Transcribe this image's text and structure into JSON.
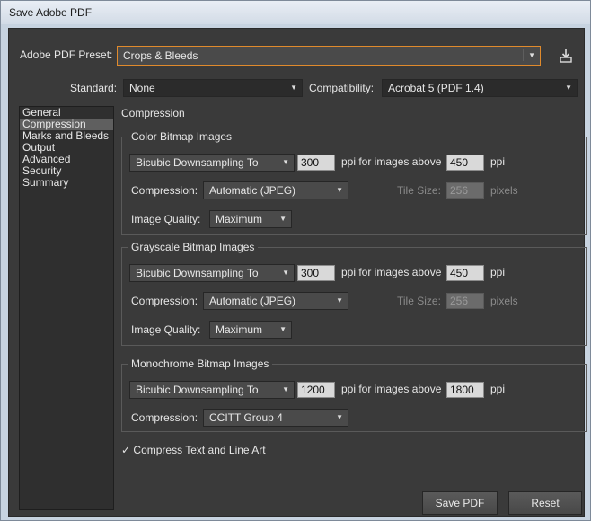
{
  "window": {
    "title": "Save Adobe PDF"
  },
  "preset": {
    "label": "Adobe PDF Preset:",
    "value": "Crops & Bleeds"
  },
  "standard": {
    "label": "Standard:",
    "value": "None"
  },
  "compatibility": {
    "label": "Compatibility:",
    "value": "Acrobat 5 (PDF 1.4)"
  },
  "sidebar": {
    "items": [
      "General",
      "Compression",
      "Marks and Bleeds",
      "Output",
      "Advanced",
      "Security",
      "Summary"
    ],
    "selected_index": 1
  },
  "section_title": "Compression",
  "color": {
    "title": "Color Bitmap Images",
    "method": "Bicubic Downsampling To",
    "ppi": "300",
    "above_label": "ppi for images above",
    "above": "450",
    "ppi_unit": "ppi",
    "compression_label": "Compression:",
    "compression": "Automatic (JPEG)",
    "tile_label": "Tile Size:",
    "tile": "256",
    "tile_unit": "pixels",
    "quality_label": "Image Quality:",
    "quality": "Maximum"
  },
  "gray": {
    "title": "Grayscale Bitmap Images",
    "method": "Bicubic Downsampling To",
    "ppi": "300",
    "above_label": "ppi for images above",
    "above": "450",
    "ppi_unit": "ppi",
    "compression_label": "Compression:",
    "compression": "Automatic (JPEG)",
    "tile_label": "Tile Size:",
    "tile": "256",
    "tile_unit": "pixels",
    "quality_label": "Image Quality:",
    "quality": "Maximum"
  },
  "mono": {
    "title": "Monochrome Bitmap Images",
    "method": "Bicubic Downsampling To",
    "ppi": "1200",
    "above_label": "ppi for images above",
    "above": "1800",
    "ppi_unit": "ppi",
    "compression_label": "Compression:",
    "compression": "CCITT Group 4"
  },
  "compress_text": {
    "label": "Compress Text and Line Art",
    "checked": true,
    "mark": "✓"
  },
  "buttons": {
    "save": "Save PDF",
    "reset": "Reset"
  },
  "icons": {
    "save_preset": "save-preset-icon",
    "dropdown": "▼"
  }
}
